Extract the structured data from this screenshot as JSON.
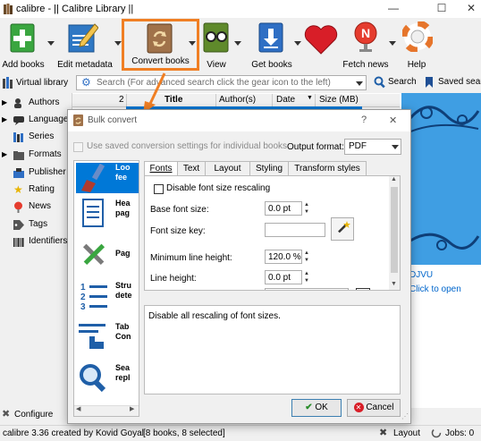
{
  "window": {
    "title": "calibre - || Calibre Library ||",
    "controls": {
      "minimize": "—",
      "maximize": "☐",
      "close": "✕"
    }
  },
  "toolbar": {
    "add_books": "Add books",
    "edit_metadata": "Edit metadata",
    "convert_books": "Convert books",
    "view": "View",
    "get_books": "Get books",
    "fetch_news": "Fetch news",
    "help": "Help"
  },
  "searchbar": {
    "virtual_library": "Virtual library",
    "placeholder": "Search (For advanced search click the gear icon to the left)",
    "search_label": "Search",
    "saved_searches": "Saved search"
  },
  "sidebar": {
    "items": [
      {
        "label": "Authors"
      },
      {
        "label": "Languages"
      },
      {
        "label": "Series"
      },
      {
        "label": "Formats"
      },
      {
        "label": "Publisher"
      },
      {
        "label": "Rating"
      },
      {
        "label": "News"
      },
      {
        "label": "Tags"
      },
      {
        "label": "Identifiers"
      }
    ],
    "configure": "Configure"
  },
  "booklist": {
    "row_number": "2",
    "columns": [
      "Title",
      "Author(s)",
      "Date",
      "Size (MB)"
    ]
  },
  "right_panel": {
    "format": "DJVU",
    "link": "Click to open"
  },
  "status": {
    "left": "calibre 3.36 created by Kovid Goyal",
    "count": "[8 books, 8 selected]",
    "layout": "Layout",
    "jobs": "Jobs: 0"
  },
  "dialog": {
    "title": "Bulk convert",
    "help": "?",
    "close": "✕",
    "use_saved": "Use saved conversion settings for individual books",
    "output_format_label": "Output format:",
    "output_format_value": "PDF",
    "categories": [
      {
        "label": "Loo\nfee"
      },
      {
        "label": "Hea\npag"
      },
      {
        "label": "Pag"
      },
      {
        "label": "Stru\ndete"
      },
      {
        "label": "Tab\nCon"
      },
      {
        "label": "Sea\nrepl"
      }
    ],
    "tabs": [
      "Fonts",
      "Text",
      "Layout",
      "Styling",
      "Transform styles"
    ],
    "disable_font_rescaling": "Disable font size rescaling",
    "base_font_size_label": "Base font size:",
    "base_font_size_value": "0.0 pt",
    "font_size_key_label": "Font size key:",
    "min_line_height_label": "Minimum line height:",
    "min_line_height_value": "120.0 %",
    "line_height_label": "Line height:",
    "line_height_value": "0.0 pt",
    "description": "Disable all rescaling of font sizes.",
    "ok": "OK",
    "cancel": "Cancel"
  },
  "colors": {
    "highlight": "#f07f24",
    "selection": "#0078d7",
    "right_bg": "#4aa5e6"
  }
}
